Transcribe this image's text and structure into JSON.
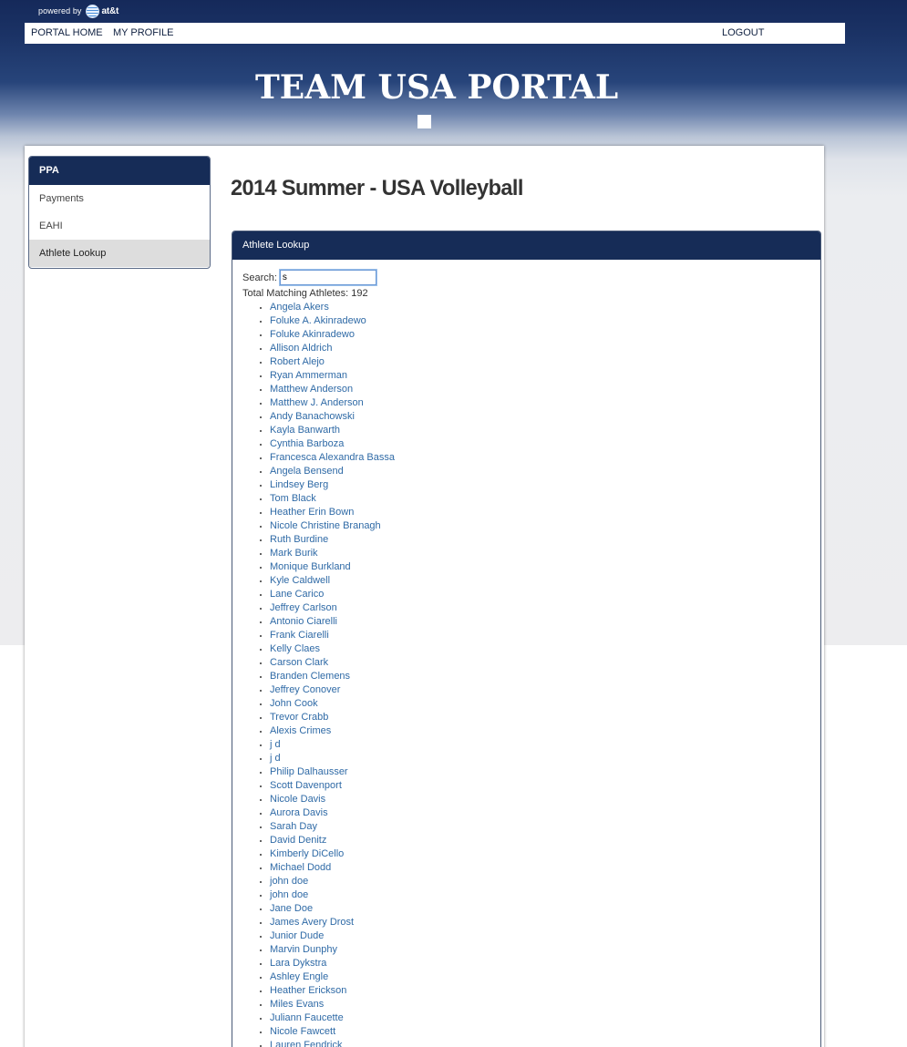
{
  "brand": {
    "powered_by": "powered by",
    "att": "at&t",
    "globe_icon": "att-globe-icon"
  },
  "topnav": {
    "portal_home": "PORTAL HOME",
    "my_profile": "MY PROFILE",
    "logout": "LOGOUT"
  },
  "header": {
    "title": "TEAM USA PORTAL"
  },
  "sidebar": {
    "heading": "PPA",
    "items": [
      {
        "label": "Payments",
        "active": false
      },
      {
        "label": "EAHI",
        "active": false
      },
      {
        "label": "Athlete Lookup",
        "active": true
      }
    ]
  },
  "main": {
    "page_title": "2014 Summer - USA Volleyball",
    "panel_title": "Athlete Lookup",
    "search_label": "Search:",
    "search_value": "s",
    "total_text": "Total Matching Athletes: 192"
  },
  "athletes": [
    "Angela Akers",
    "Foluke A. Akinradewo",
    "Foluke Akinradewo",
    "Allison Aldrich",
    "Robert Alejo",
    "Ryan Ammerman",
    "Matthew Anderson",
    "Matthew J. Anderson",
    "Andy Banachowski",
    "Kayla Banwarth",
    "Cynthia Barboza",
    "Francesca Alexandra Bassa",
    "Angela Bensend",
    "Lindsey Berg",
    "Tom Black",
    "Heather Erin Bown",
    "Nicole Christine Branagh",
    "Ruth Burdine",
    "Mark Burik",
    "Monique Burkland",
    "Kyle Caldwell",
    "Lane Carico",
    "Jeffrey Carlson",
    "Antonio Ciarelli",
    "Frank Ciarelli",
    "Kelly Claes",
    "Carson Clark",
    "Branden Clemens",
    "Jeffrey Conover",
    "John Cook",
    "Trevor Crabb",
    "Alexis Crimes",
    "j d",
    "j d",
    "Philip Dalhausser",
    "Scott Davenport",
    "Nicole Davis",
    "Aurora Davis",
    "Sarah Day",
    "David Denitz",
    "Kimberly DiCello",
    "Michael Dodd",
    "john doe",
    "john doe",
    "Jane Doe",
    "James Avery Drost",
    "Junior Dude",
    "Marvin Dunphy",
    "Lara Dykstra",
    "Ashley Engle",
    "Heather Erickson",
    "Miles Evans",
    "Juliann Faucette",
    "Nicole Fawcett",
    "Lauren Fendrick"
  ],
  "colors": {
    "navy": "#162c57",
    "link": "#2f6aa6",
    "page_bg": "#ededef"
  }
}
